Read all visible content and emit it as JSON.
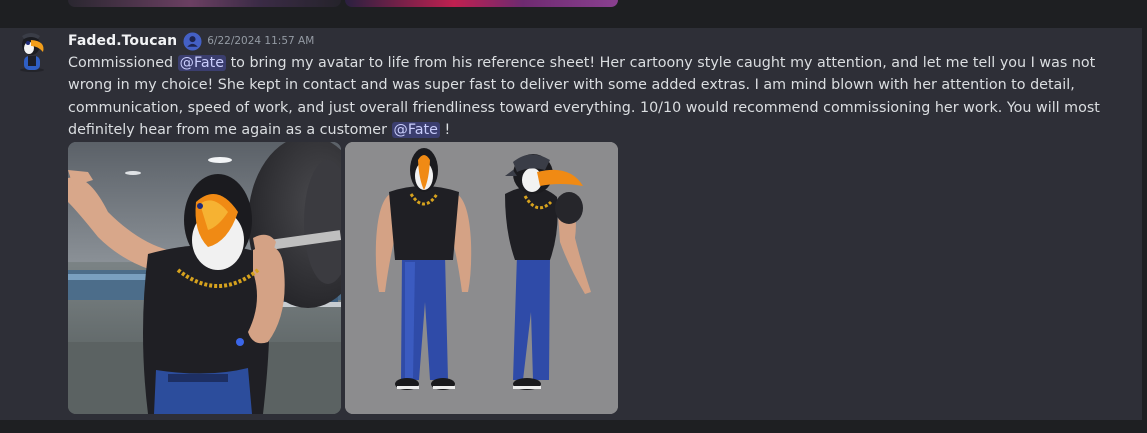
{
  "message": {
    "author": "Faded.Toucan",
    "role_icon": "user-icon",
    "timestamp": "6/22/2024 11:57 AM",
    "text_parts": [
      "Commissioned ",
      "@Fate",
      " to bring my avatar to life from his reference sheet! Her cartoony style caught my attention, and let me tell you I was not wrong in my choice! She kept in contact and was super fast to deliver with some added extras. I am mind blown with her attention to detail, communication, speed of work, and just overall friendliness toward everything. 10/10 would recommend commissioning her work. You will most definitely hear from me again as a customer ",
      "@Fate",
      " !"
    ],
    "attachments": [
      {
        "icon": "toucan-avatar-render-image"
      },
      {
        "icon": "toucan-reference-sheet-image"
      }
    ]
  },
  "colors": {
    "background": "#1e1f22",
    "message_highlight": "#2e2f37",
    "text": "#dbdee1",
    "author": "#f2f3f5",
    "timestamp": "#949ba4",
    "mention_bg": "#3c4270",
    "mention_text": "#c9cdfb",
    "role_icon": "#5865f2"
  }
}
